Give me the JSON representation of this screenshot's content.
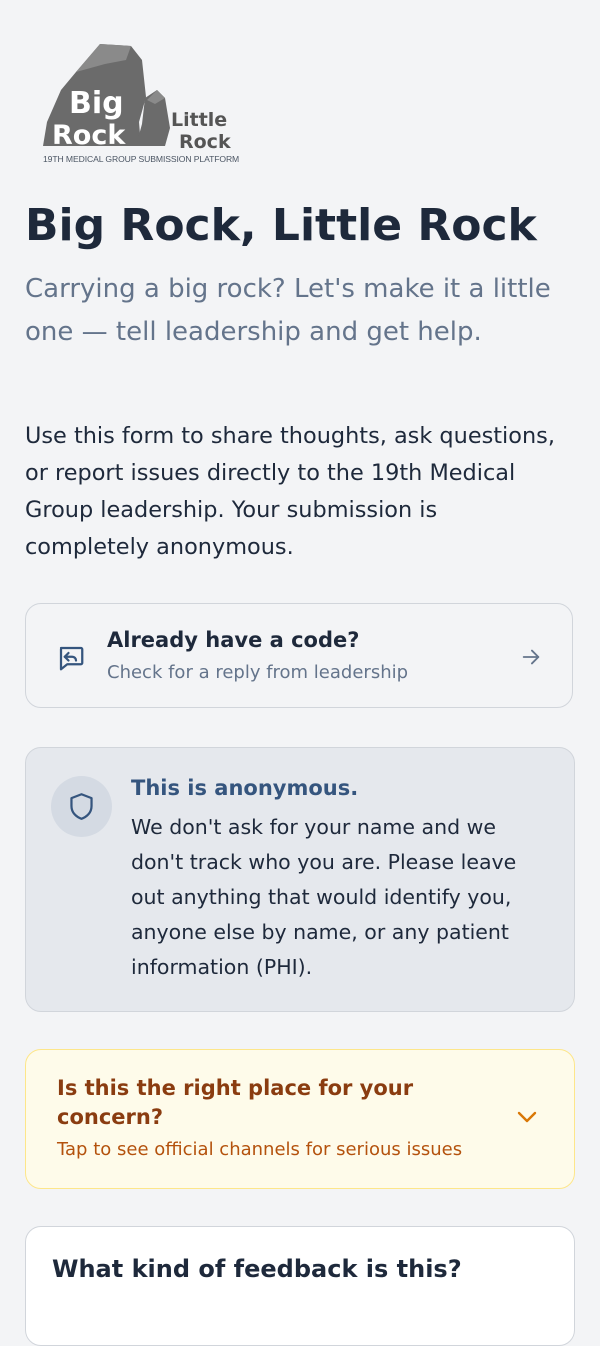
{
  "logo": {
    "word_big": "Big",
    "word_rock_1": "Rock",
    "word_little": "Little",
    "word_rock_2": "Rock",
    "caption": "19TH MEDICAL GROUP SUBMISSION PLATFORM"
  },
  "header": {
    "title": "Big Rock, Little Rock",
    "subtitle": "Carrying a big rock? Let's make it a little one — tell leadership and get help.",
    "intro": "Use this form to share thoughts, ask questions, or report issues directly to the 19th Medical Group leadership. Your submission is completely anonymous."
  },
  "code_card": {
    "icon": "message-reply-icon",
    "title": "Already have a code?",
    "subtitle": "Check for a reply from leadership",
    "arrow_icon": "arrow-right-icon"
  },
  "anonymous_card": {
    "icon": "shield-icon",
    "title": "This is anonymous.",
    "body": "We don't ask for your name and we don't track who you are. Please leave out anything that would identify you, anyone else by name, or any patient information (PHI)."
  },
  "concern_card": {
    "title": "Is this the right place for your concern?",
    "subtitle": "Tap to see official channels for serious issues",
    "chevron_icon": "chevron-down-icon"
  },
  "feedback_kind": {
    "title": "What kind of feedback is this?"
  },
  "colors": {
    "background": "#f3f4f6",
    "text_primary": "#1e293b",
    "text_muted": "#64748b",
    "anon_title": "#35557e",
    "warning_text": "#8a3c10",
    "warning_accent": "#d97706"
  }
}
